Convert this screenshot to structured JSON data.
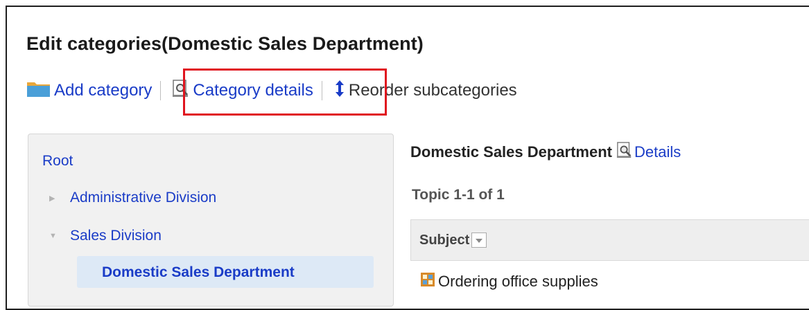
{
  "page": {
    "title": "Edit categories(Domestic Sales Department)"
  },
  "toolbar": {
    "add_category": "Add category",
    "category_details": "Category details",
    "reorder_subcategories": "Reorder subcategories",
    "icons": {
      "add": "folder-icon",
      "details": "magnifier-document-icon",
      "reorder": "up-down-arrow-icon"
    }
  },
  "tree": {
    "root": "Root",
    "items": [
      {
        "label": "Administrative Division",
        "state": "collapsed"
      },
      {
        "label": "Sales Division",
        "state": "expanded"
      }
    ],
    "selected": "Domestic Sales Department"
  },
  "detail": {
    "category_name": "Domestic Sales Department",
    "details_link": "Details",
    "topic_count": "Topic 1-1 of 1",
    "columns": [
      "Subject"
    ],
    "rows": [
      {
        "subject": "Ordering office supplies",
        "icon": "topic-icon"
      }
    ]
  },
  "colors": {
    "link": "#1a3cc7",
    "highlight": "#e0141e",
    "selected_bg": "#dde9f6"
  }
}
